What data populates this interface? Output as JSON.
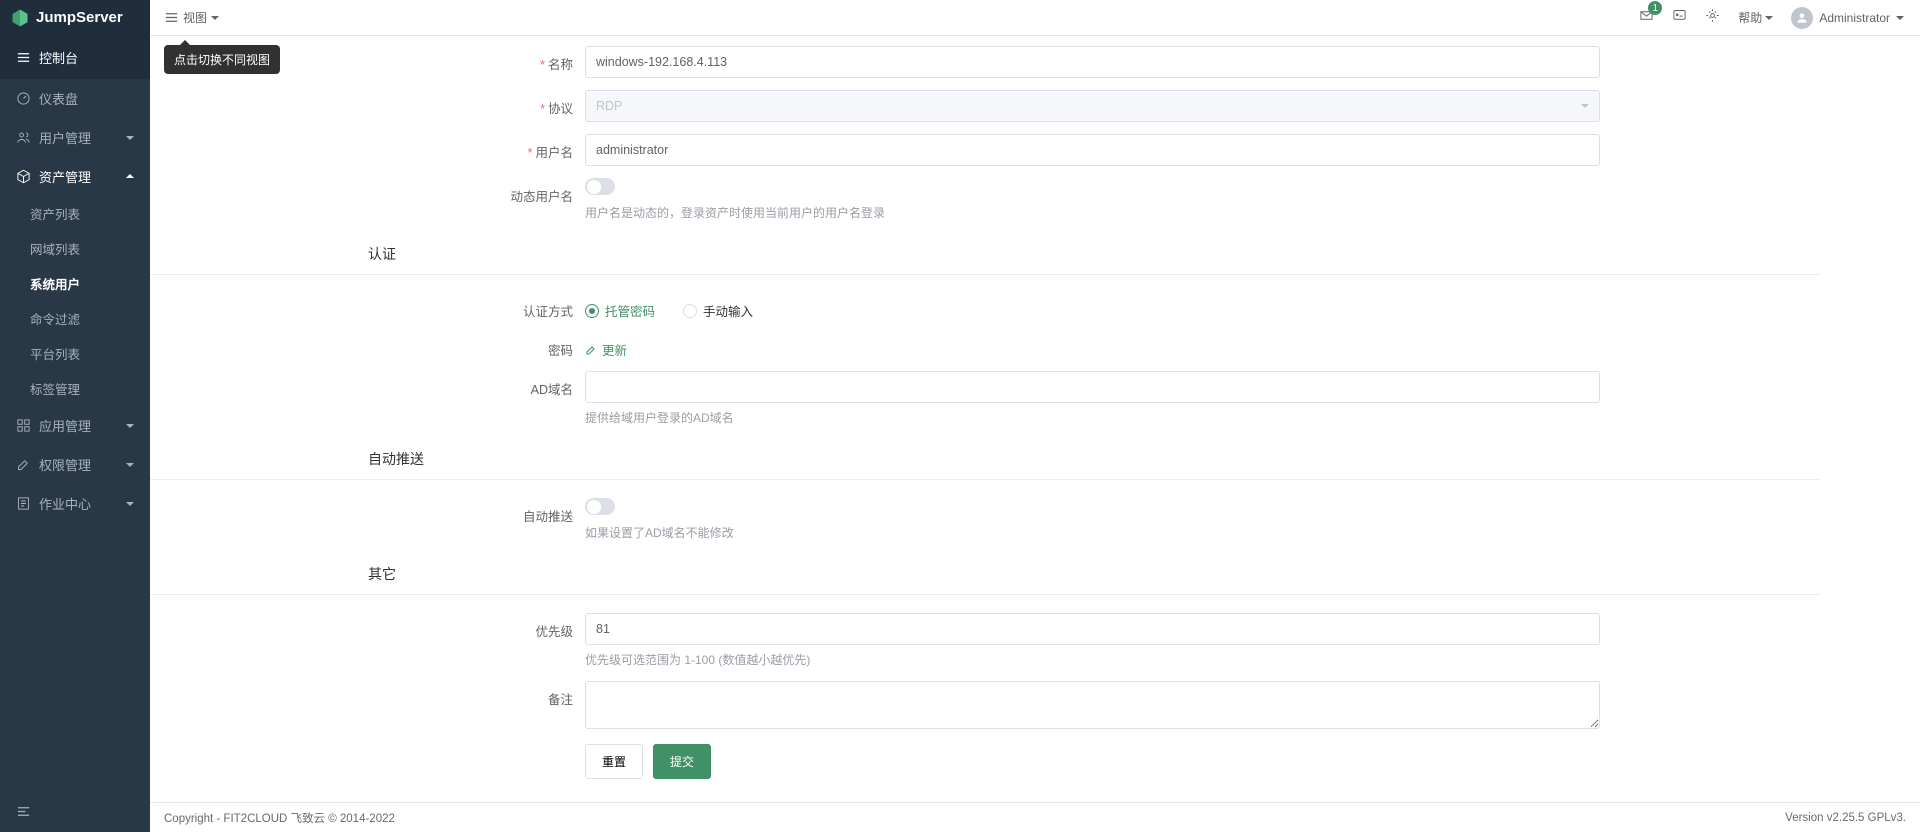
{
  "brand": "JumpServer",
  "topbar": {
    "view_label": "视图",
    "tooltip": "点击切换不同视图",
    "help_label": "帮助",
    "user_name": "Administrator",
    "badge_count": "1"
  },
  "sidebar": {
    "console_label": "控制台",
    "items": [
      {
        "label": "仪表盘",
        "icon": "gauge"
      },
      {
        "label": "用户管理",
        "icon": "users",
        "expandable": true
      },
      {
        "label": "资产管理",
        "icon": "cube",
        "expandable": true,
        "active": true
      },
      {
        "label": "应用管理",
        "icon": "grid",
        "expandable": true
      },
      {
        "label": "权限管理",
        "icon": "edit",
        "expandable": true
      },
      {
        "label": "作业中心",
        "icon": "task",
        "expandable": true
      }
    ],
    "asset_subs": [
      {
        "label": "资产列表"
      },
      {
        "label": "网域列表"
      },
      {
        "label": "系统用户",
        "active": true
      },
      {
        "label": "命令过滤"
      },
      {
        "label": "平台列表"
      },
      {
        "label": "标签管理"
      }
    ]
  },
  "form": {
    "name_label": "名称",
    "name_value": "windows-192.168.4.113",
    "protocol_label": "协议",
    "protocol_value": "RDP",
    "username_label": "用户名",
    "username_value": "administrator",
    "dynamic_user_label": "动态用户名",
    "dynamic_user_help": "用户名是动态的，登录资产时使用当前用户的用户名登录",
    "auth_section": "认证",
    "auth_method_label": "认证方式",
    "auth_option_managed": "托管密码",
    "auth_option_manual": "手动输入",
    "password_label": "密码",
    "password_update": "更新",
    "ad_domain_label": "AD域名",
    "ad_domain_help": "提供给域用户登录的AD域名",
    "push_section": "自动推送",
    "push_label": "自动推送",
    "push_help": "如果设置了AD域名不能修改",
    "other_section": "其它",
    "priority_label": "优先级",
    "priority_value": "81",
    "priority_help": "优先级可选范围为 1-100 (数值越小越优先)",
    "remark_label": "备注",
    "btn_reset": "重置",
    "btn_submit": "提交"
  },
  "footer": {
    "copyright": "Copyright - FIT2CLOUD 飞致云 © 2014-2022",
    "version": "Version v2.25.5 GPLv3."
  }
}
